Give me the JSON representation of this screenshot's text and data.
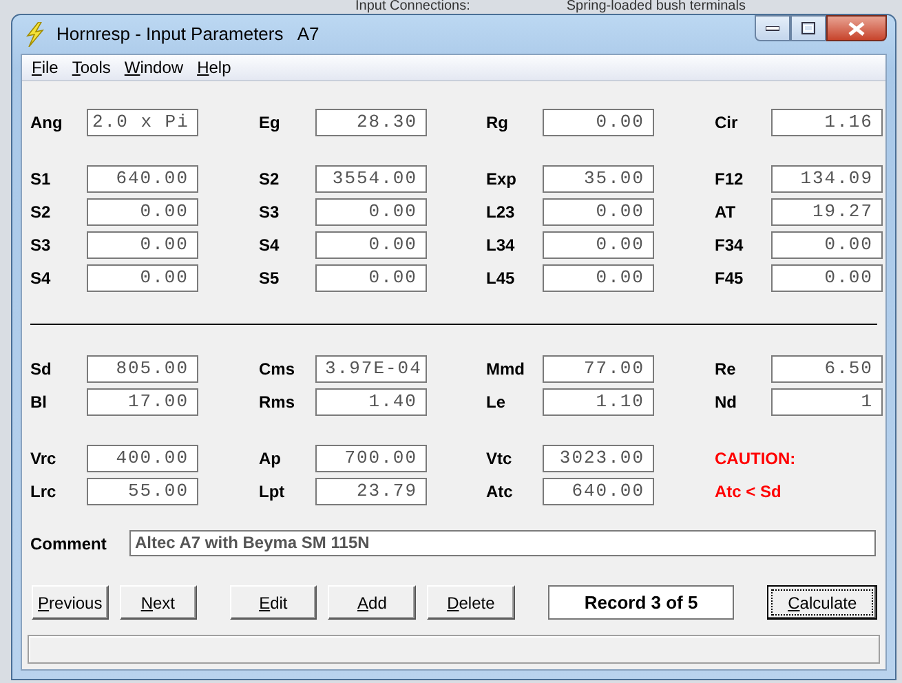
{
  "background_window": {
    "texts": [
      "Input Connections:",
      "Spring-loaded bush terminals"
    ]
  },
  "window": {
    "title": "Hornresp - Input Parameters   A7"
  },
  "menu": [
    {
      "label": "File"
    },
    {
      "label": "Tools"
    },
    {
      "label": "Window"
    },
    {
      "label": "Help"
    }
  ],
  "groups": [
    {
      "rows": [
        [
          {
            "kind": "choice",
            "label": "Ang",
            "value": "2.0 x Pi"
          },
          {
            "kind": "field",
            "label": "Eg",
            "value": "28.30"
          },
          {
            "kind": "field",
            "label": "Rg",
            "value": "0.00"
          },
          {
            "kind": "field",
            "label": "Cir",
            "value": "1.16"
          }
        ]
      ]
    },
    {
      "rows": [
        [
          {
            "kind": "field",
            "label": "S1",
            "value": "640.00"
          },
          {
            "kind": "field",
            "label": "S2",
            "value": "3554.00"
          },
          {
            "kind": "field",
            "label": "Exp",
            "value": "35.00"
          },
          {
            "kind": "field",
            "label": "F12",
            "value": "134.09"
          }
        ],
        [
          {
            "kind": "field",
            "label": "S2",
            "value": "0.00"
          },
          {
            "kind": "field",
            "label": "S3",
            "value": "0.00"
          },
          {
            "kind": "field",
            "label": "L23",
            "value": "0.00"
          },
          {
            "kind": "field",
            "label": "AT",
            "value": "19.27"
          }
        ],
        [
          {
            "kind": "field",
            "label": "S3",
            "value": "0.00"
          },
          {
            "kind": "field",
            "label": "S4",
            "value": "0.00"
          },
          {
            "kind": "field",
            "label": "L34",
            "value": "0.00"
          },
          {
            "kind": "field",
            "label": "F34",
            "value": "0.00"
          }
        ],
        [
          {
            "kind": "field",
            "label": "S4",
            "value": "0.00"
          },
          {
            "kind": "field",
            "label": "S5",
            "value": "0.00"
          },
          {
            "kind": "field",
            "label": "L45",
            "value": "0.00"
          },
          {
            "kind": "field",
            "label": "F45",
            "value": "0.00"
          }
        ]
      ]
    },
    {
      "kind": "divider"
    },
    {
      "rows": [
        [
          {
            "kind": "field",
            "label": "Sd",
            "value": "805.00"
          },
          {
            "kind": "field",
            "label": "Cms",
            "value": "3.97E-04"
          },
          {
            "kind": "field",
            "label": "Mmd",
            "value": "77.00"
          },
          {
            "kind": "field",
            "label": "Re",
            "value": "6.50"
          }
        ],
        [
          {
            "kind": "field",
            "label": "Bl",
            "value": "17.00"
          },
          {
            "kind": "field",
            "label": "Rms",
            "value": "1.40"
          },
          {
            "kind": "field",
            "label": "Le",
            "value": "1.10"
          },
          {
            "kind": "field",
            "label": "Nd",
            "value": "1"
          }
        ]
      ]
    },
    {
      "rows": [
        [
          {
            "kind": "field",
            "label": "Vrc",
            "value": "400.00"
          },
          {
            "kind": "field",
            "label": "Ap",
            "value": "700.00"
          },
          {
            "kind": "field",
            "label": "Vtc",
            "value": "3023.00"
          },
          {
            "kind": "warning",
            "text": "CAUTION:"
          }
        ],
        [
          {
            "kind": "field",
            "label": "Lrc",
            "value": "55.00"
          },
          {
            "kind": "field",
            "label": "Lpt",
            "value": "23.79"
          },
          {
            "kind": "field",
            "label": "Atc",
            "value": "640.00"
          },
          {
            "kind": "warning",
            "text": "Atc < Sd"
          }
        ]
      ]
    }
  ],
  "comment": {
    "label": "Comment",
    "value": "Altec A7 with Beyma SM 115N"
  },
  "nav_buttons": [
    {
      "label": "Previous",
      "focused": false
    },
    {
      "label": "Next",
      "focused": false
    }
  ],
  "record_buttons": [
    {
      "label": "Edit",
      "focused": false
    },
    {
      "label": "Add",
      "focused": false
    },
    {
      "label": "Delete",
      "focused": false
    }
  ],
  "record_status": "Record 3 of 5",
  "calculate_button": {
    "label": "Calculate",
    "focused": true
  }
}
